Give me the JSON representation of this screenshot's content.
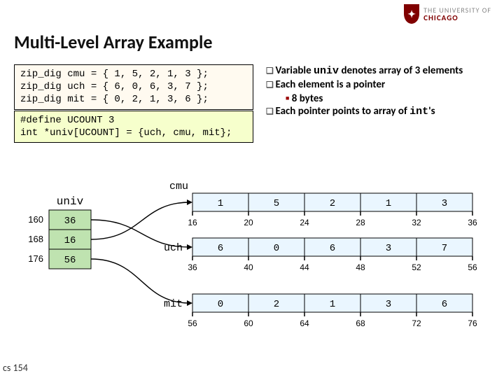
{
  "logo": {
    "the": "THE UNIVERSITY OF",
    "uni": "CHICAGO"
  },
  "title": "Multi-Level Array Example",
  "code1": "zip_dig cmu = { 1, 5, 2, 1, 3 };\nzip_dig uch = { 6, 0, 6, 3, 7 };\nzip_dig mit = { 0, 2, 1, 3, 6 };",
  "code2": "#define UCOUNT 3\nint *univ[UCOUNT] = {uch, cmu, mit};",
  "bullets": {
    "l1a_pre": "Variable ",
    "l1a_code": "univ",
    "l1a_post": " denotes array of 3 elements",
    "l1b": "Each element is a pointer",
    "l2": "8 bytes",
    "l1c_pre": "Each pointer points to array of ",
    "l1c_code": "int",
    "l1c_post": "'s"
  },
  "diagram": {
    "univ_label": "univ",
    "univ_addrs": [
      "160",
      "168",
      "176"
    ],
    "univ_vals": [
      "36",
      "16",
      "56"
    ],
    "arrays": [
      {
        "name": "cmu",
        "vals": [
          "1",
          "5",
          "2",
          "1",
          "3"
        ],
        "addrs": [
          "16",
          "20",
          "24",
          "28",
          "32",
          "36"
        ]
      },
      {
        "name": "uch",
        "vals": [
          "6",
          "0",
          "6",
          "3",
          "7"
        ],
        "addrs": [
          "36",
          "40",
          "44",
          "48",
          "52",
          "56"
        ]
      },
      {
        "name": "mit",
        "vals": [
          "0",
          "2",
          "1",
          "3",
          "6"
        ],
        "addrs": [
          "56",
          "60",
          "64",
          "68",
          "72",
          "76"
        ]
      }
    ]
  },
  "footer": "cs 154"
}
